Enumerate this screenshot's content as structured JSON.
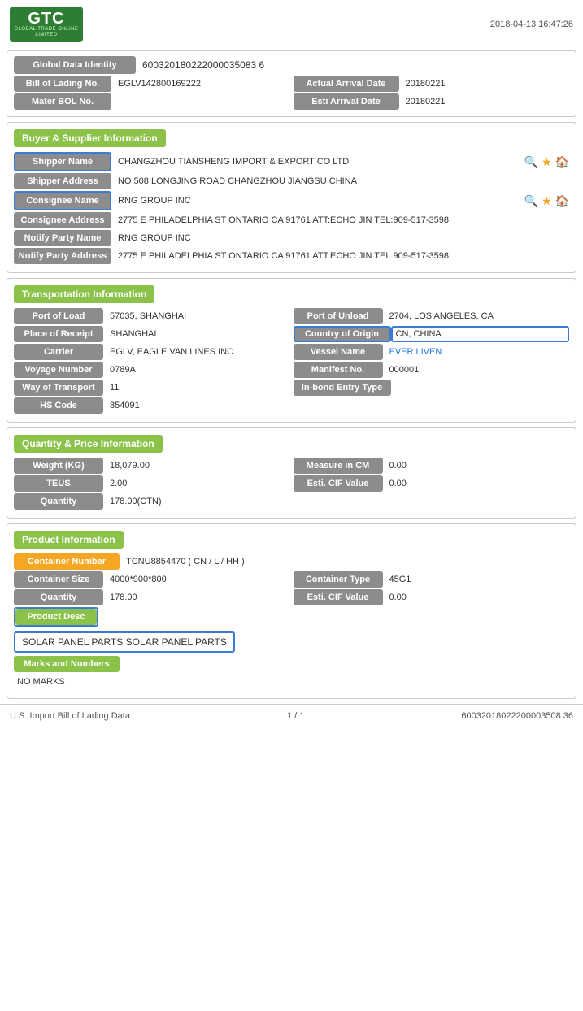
{
  "header": {
    "logo_text": "GTC",
    "logo_tagline": "GLOBAL TRADE ONLINE LIMITED",
    "timestamp": "2018-04-13 16:47:26"
  },
  "top_section": {
    "global_data_identity_label": "Global Data Identity",
    "global_data_identity_value": "600320180222000035083 6",
    "bill_of_lading_label": "Bill of Lading No.",
    "bill_of_lading_value": "EGLV142800169222",
    "actual_arrival_date_label": "Actual Arrival Date",
    "actual_arrival_date_value": "20180221",
    "mater_bol_label": "Mater BOL No.",
    "mater_bol_value": "",
    "esti_arrival_date_label": "Esti Arrival Date",
    "esti_arrival_date_value": "20180221"
  },
  "buyer_supplier": {
    "section_title": "Buyer & Supplier Information",
    "shipper_name_label": "Shipper Name",
    "shipper_name_value": "CHANGZHOU TIANSHENG IMPORT & EXPORT CO LTD",
    "shipper_address_label": "Shipper Address",
    "shipper_address_value": "NO 508 LONGJING ROAD CHANGZHOU JIANGSU CHINA",
    "consignee_name_label": "Consignee Name",
    "consignee_name_value": "RNG GROUP INC",
    "consignee_address_label": "Consignee Address",
    "consignee_address_value": "2775 E PHILADELPHIA ST ONTARIO CA 91761 ATT:ECHO JIN TEL:909-517-3598",
    "notify_party_name_label": "Notify Party Name",
    "notify_party_name_value": "RNG GROUP INC",
    "notify_party_address_label": "Notify Party Address",
    "notify_party_address_value": "2775 E PHILADELPHIA ST ONTARIO CA 91761 ATT:ECHO JIN TEL:909-517-3598"
  },
  "transportation": {
    "section_title": "Transportation Information",
    "port_of_load_label": "Port of Load",
    "port_of_load_value": "57035, SHANGHAI",
    "port_of_unload_label": "Port of Unload",
    "port_of_unload_value": "2704, LOS ANGELES, CA",
    "place_of_receipt_label": "Place of Receipt",
    "place_of_receipt_value": "SHANGHAI",
    "country_of_origin_label": "Country of Origin",
    "country_of_origin_value": "CN, CHINA",
    "carrier_label": "Carrier",
    "carrier_value": "EGLV, EAGLE VAN LINES INC",
    "vessel_name_label": "Vessel Name",
    "vessel_name_value": "EVER LIVEN",
    "voyage_number_label": "Voyage Number",
    "voyage_number_value": "0789A",
    "manifest_no_label": "Manifest No.",
    "manifest_no_value": "000001",
    "way_of_transport_label": "Way of Transport",
    "way_of_transport_value": "11",
    "in_bond_entry_label": "In-bond Entry Type",
    "in_bond_entry_value": "",
    "hs_code_label": "HS Code",
    "hs_code_value": "854091"
  },
  "quantity_price": {
    "section_title": "Quantity & Price Information",
    "weight_label": "Weight (KG)",
    "weight_value": "18,079.00",
    "measure_in_cm_label": "Measure in CM",
    "measure_in_cm_value": "0.00",
    "teus_label": "TEUS",
    "teus_value": "2.00",
    "esti_cif_label": "Esti. CIF Value",
    "esti_cif_value": "0.00",
    "quantity_label": "Quantity",
    "quantity_value": "178.00(CTN)"
  },
  "product_information": {
    "section_title": "Product Information",
    "container_number_label": "Container Number",
    "container_number_value": "TCNU8854470 ( CN / L / HH )",
    "container_size_label": "Container Size",
    "container_size_value": "4000*900*800",
    "container_type_label": "Container Type",
    "container_type_value": "45G1",
    "quantity_label": "Quantity",
    "quantity_value": "178.00",
    "esti_cif_label": "Esti. CIF Value",
    "esti_cif_value": "0.00",
    "product_desc_label": "Product Desc",
    "product_desc_value": "SOLAR PANEL PARTS SOLAR PANEL PARTS",
    "marks_and_numbers_label": "Marks and Numbers",
    "marks_and_numbers_value": "NO MARKS"
  },
  "footer": {
    "left_text": "U.S. Import Bill of Lading Data",
    "page_info": "1 / 1",
    "right_text": "60032018022200003508 36"
  }
}
